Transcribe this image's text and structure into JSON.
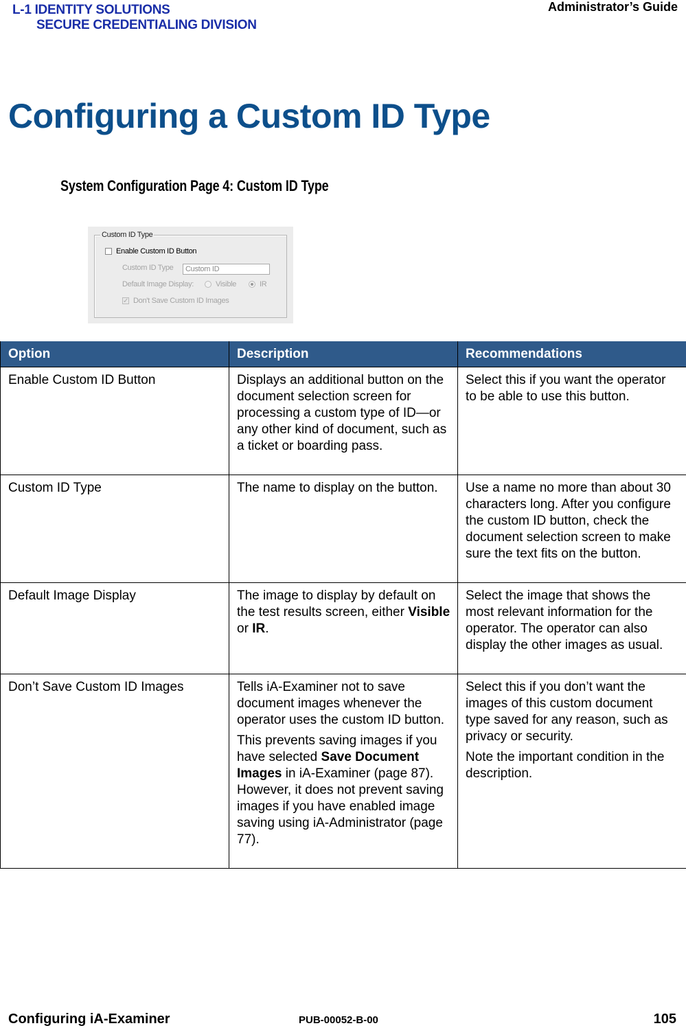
{
  "header": {
    "logo_line1": "L-1 IDENTITY SOLUTIONS",
    "logo_line2": "SECURE CREDENTIALING DIVISION",
    "guide_title": "Administrator’s Guide",
    "brand_color": "#1a2ea8"
  },
  "page_title": "Configuring a Custom ID Type",
  "figure_caption": "System Configuration Page 4: Custom ID Type",
  "dialog": {
    "group_label": "Custom ID Type",
    "enable_checkbox": {
      "label": "Enable Custom ID Button",
      "checked": false
    },
    "custom_id_type": {
      "label": "Custom ID Type",
      "value": "Custom ID"
    },
    "default_image_display": {
      "label": "Default Image Display:",
      "options": [
        "Visible",
        "IR"
      ],
      "selected": "IR"
    },
    "dont_save_checkbox": {
      "label": "Don't Save Custom ID Images",
      "checked": true,
      "check_glyph": "✓"
    }
  },
  "table": {
    "header_color": "#2f5a8a",
    "columns": [
      "Option",
      "Description",
      "Recommendations"
    ],
    "rows": [
      {
        "option": "Enable Custom ID Button",
        "description": [
          "Displays an additional button on the document selection screen for processing a custom type of ID—or any other kind of document, such as a ticket or boarding pass."
        ],
        "recommendations": [
          "Select this if you want the operator to be able to use this button."
        ]
      },
      {
        "option": "Custom ID Type",
        "description": [
          "The name to display on the button."
        ],
        "recommendations": [
          "Use a name no more than about 30 characters long. After you configure the custom ID button, check the document selection screen to make sure the text fits on the button."
        ]
      },
      {
        "option": "Default Image Display",
        "description_parts": {
          "pre": "The image to display by default on the test results screen, either ",
          "bold1": "Visible",
          "mid": " or ",
          "bold2": "IR",
          "post": "."
        },
        "recommendations": [
          "Select the image that shows the most relevant information for the operator. The operator can also display the other images as usual."
        ]
      },
      {
        "option": "Don’t Save Custom ID Images",
        "description_p1": "Tells iA-Examiner not to save document images whenever the operator uses the custom ID button.",
        "description_p2_parts": {
          "pre": "This prevents saving images if you have selected ",
          "bold": "Save Document Images",
          "post": " in iA-Examiner (page 87). However, it does not prevent saving images if you have enabled image saving using iA-Administrator (page 77)."
        },
        "recommendations": [
          "Select this if you don’t want the images of this custom document type saved for any reason, such as privacy or security.",
          "Note the important condition in the description."
        ]
      }
    ]
  },
  "footer": {
    "section": "Configuring iA-Examiner",
    "pub_number": "PUB-00052-B-00",
    "page_number": "105"
  }
}
